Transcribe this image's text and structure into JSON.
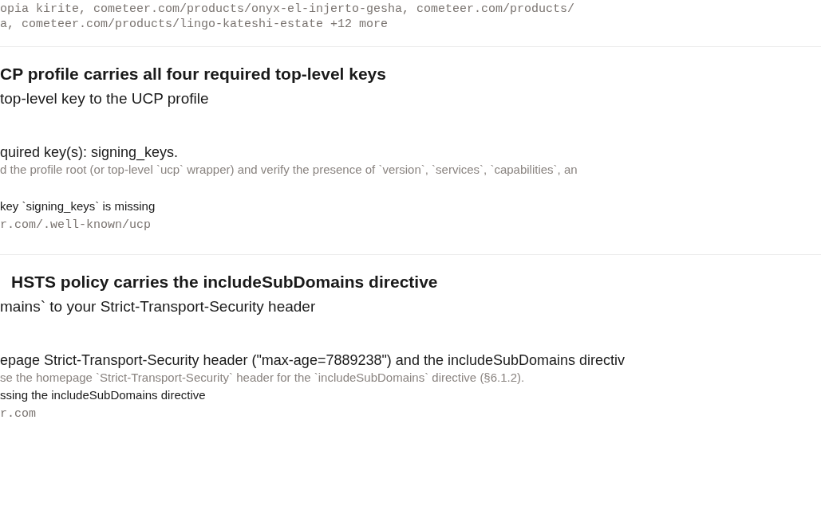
{
  "evidence_urls": [
    "opia kirite, cometeer.com/products/onyx-el-injerto-gesha, cometeer.com/products/",
    "a, cometeer.com/products/lingo-kateshi-estate +12 more"
  ],
  "checks": [
    {
      "title": "CP profile carries all four required top-level keys",
      "fix": "top-level key to the UCP profile",
      "finding": "quired key(s): signing_keys.",
      "method": "d the profile root (or top-level `ucp` wrapper) and verify the presence of `version`, `services`, `capabilities`, an",
      "detail": "key `signing_keys` is missing",
      "url": "r.com/.well-known/ucp"
    },
    {
      "title": "HSTS policy carries the includeSubDomains directive",
      "fix": "mains` to your Strict-Transport-Security header",
      "finding": "epage Strict-Transport-Security header (\"max-age=7889238\") and the includeSubDomains directiv",
      "method": "se the homepage `Strict-Transport-Security` header for the `includeSubDomains` directive (§6.1.2).",
      "detail": "ssing the includeSubDomains directive",
      "url": "r.com"
    }
  ]
}
